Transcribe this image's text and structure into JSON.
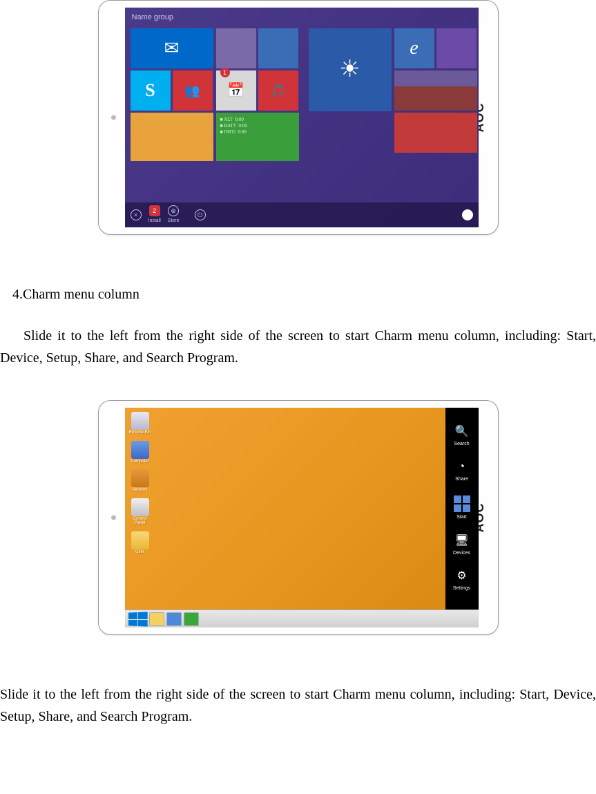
{
  "brand": "AOC",
  "section": {
    "number": "4.",
    "title": "Charm menu column"
  },
  "para1": "Slide it to the left from the right side of the screen to start Charm menu column, including: Start, Device, Setup, Share, and Search Program.",
  "para2": "Slide it to the left from the right side of the screen to start Charm menu column, including: Start, Device, Setup, Share, and Search Program.",
  "start_screen": {
    "header": "Name group",
    "calendar_badge": "1",
    "taskbar": [
      "2",
      "Install",
      "Store",
      "",
      ""
    ],
    "green_tile_lines": "■ ALT  0:00\n■ BATT  0:00\n■ INFO  0:00"
  },
  "charms": {
    "search": "Search",
    "share": "Share",
    "start": "Start",
    "devices": "Devices",
    "settings": "Settings"
  },
  "desktop_icons": [
    "Recycle Bin",
    "Computer",
    "Network",
    "Control Panel",
    "User"
  ]
}
